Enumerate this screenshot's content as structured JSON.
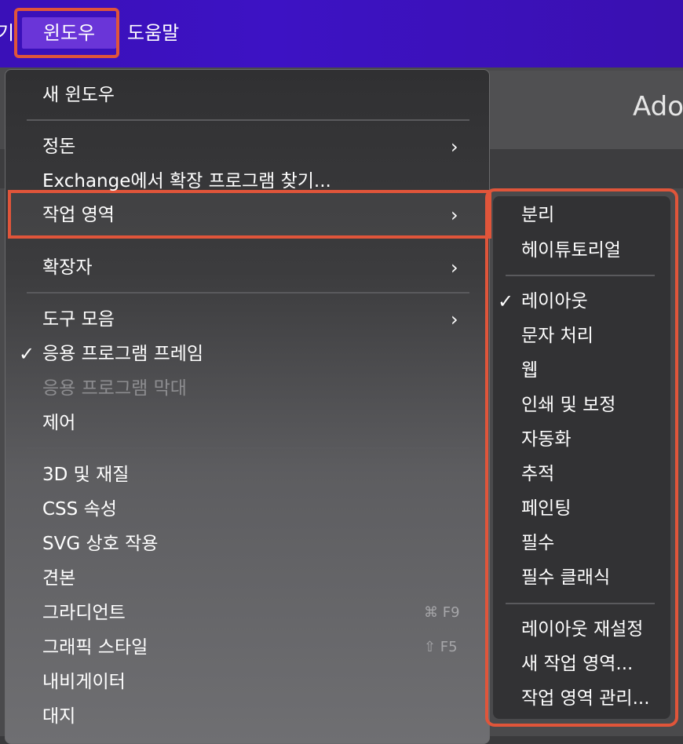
{
  "menubar": {
    "left_item": "기",
    "window": "윈도우",
    "help": "도움말"
  },
  "app": {
    "title_partial": "Ado"
  },
  "window_menu": {
    "new_window": "새 윈도우",
    "arrange": "정돈",
    "find_extensions": "Exchange에서 확장 프로그램 찾기...",
    "workspace": "작업 영역",
    "extensions": "확장자",
    "toolbars": "도구 모음",
    "app_frame": "응용 프로그램 프레임",
    "app_bar": "응용 프로그램 막대",
    "control": "제어",
    "3d_materials": "3D 및 재질",
    "css_properties": "CSS 속성",
    "svg_interactivity": "SVG 상호 작용",
    "swatches": "견본",
    "gradient": "그라디언트",
    "gradient_shortcut": "⌘ F9",
    "graphic_styles": "그래픽 스타일",
    "graphic_styles_shortcut": "⇧ F5",
    "navigator": "내비게이터",
    "artboards": "대지"
  },
  "workspace_submenu": {
    "items_group1": [
      "분리",
      "헤이튜토리얼"
    ],
    "items_group2": [
      "레이아웃",
      "문자 처리",
      "웹",
      "인쇄 및 보정",
      "자동화",
      "추적",
      "페인팅",
      "필수",
      "필수 클래식"
    ],
    "items_group3": [
      "레이아웃 재설정",
      "새 작업 영역...",
      "작업 영역 관리..."
    ],
    "checked_item": "레이아웃"
  },
  "glyphs": {
    "check": "✓",
    "chevron": "›"
  },
  "colors": {
    "menubar": "#3d12c4",
    "highlight": "#e0553a",
    "selected_menu": "#6a35d8"
  }
}
